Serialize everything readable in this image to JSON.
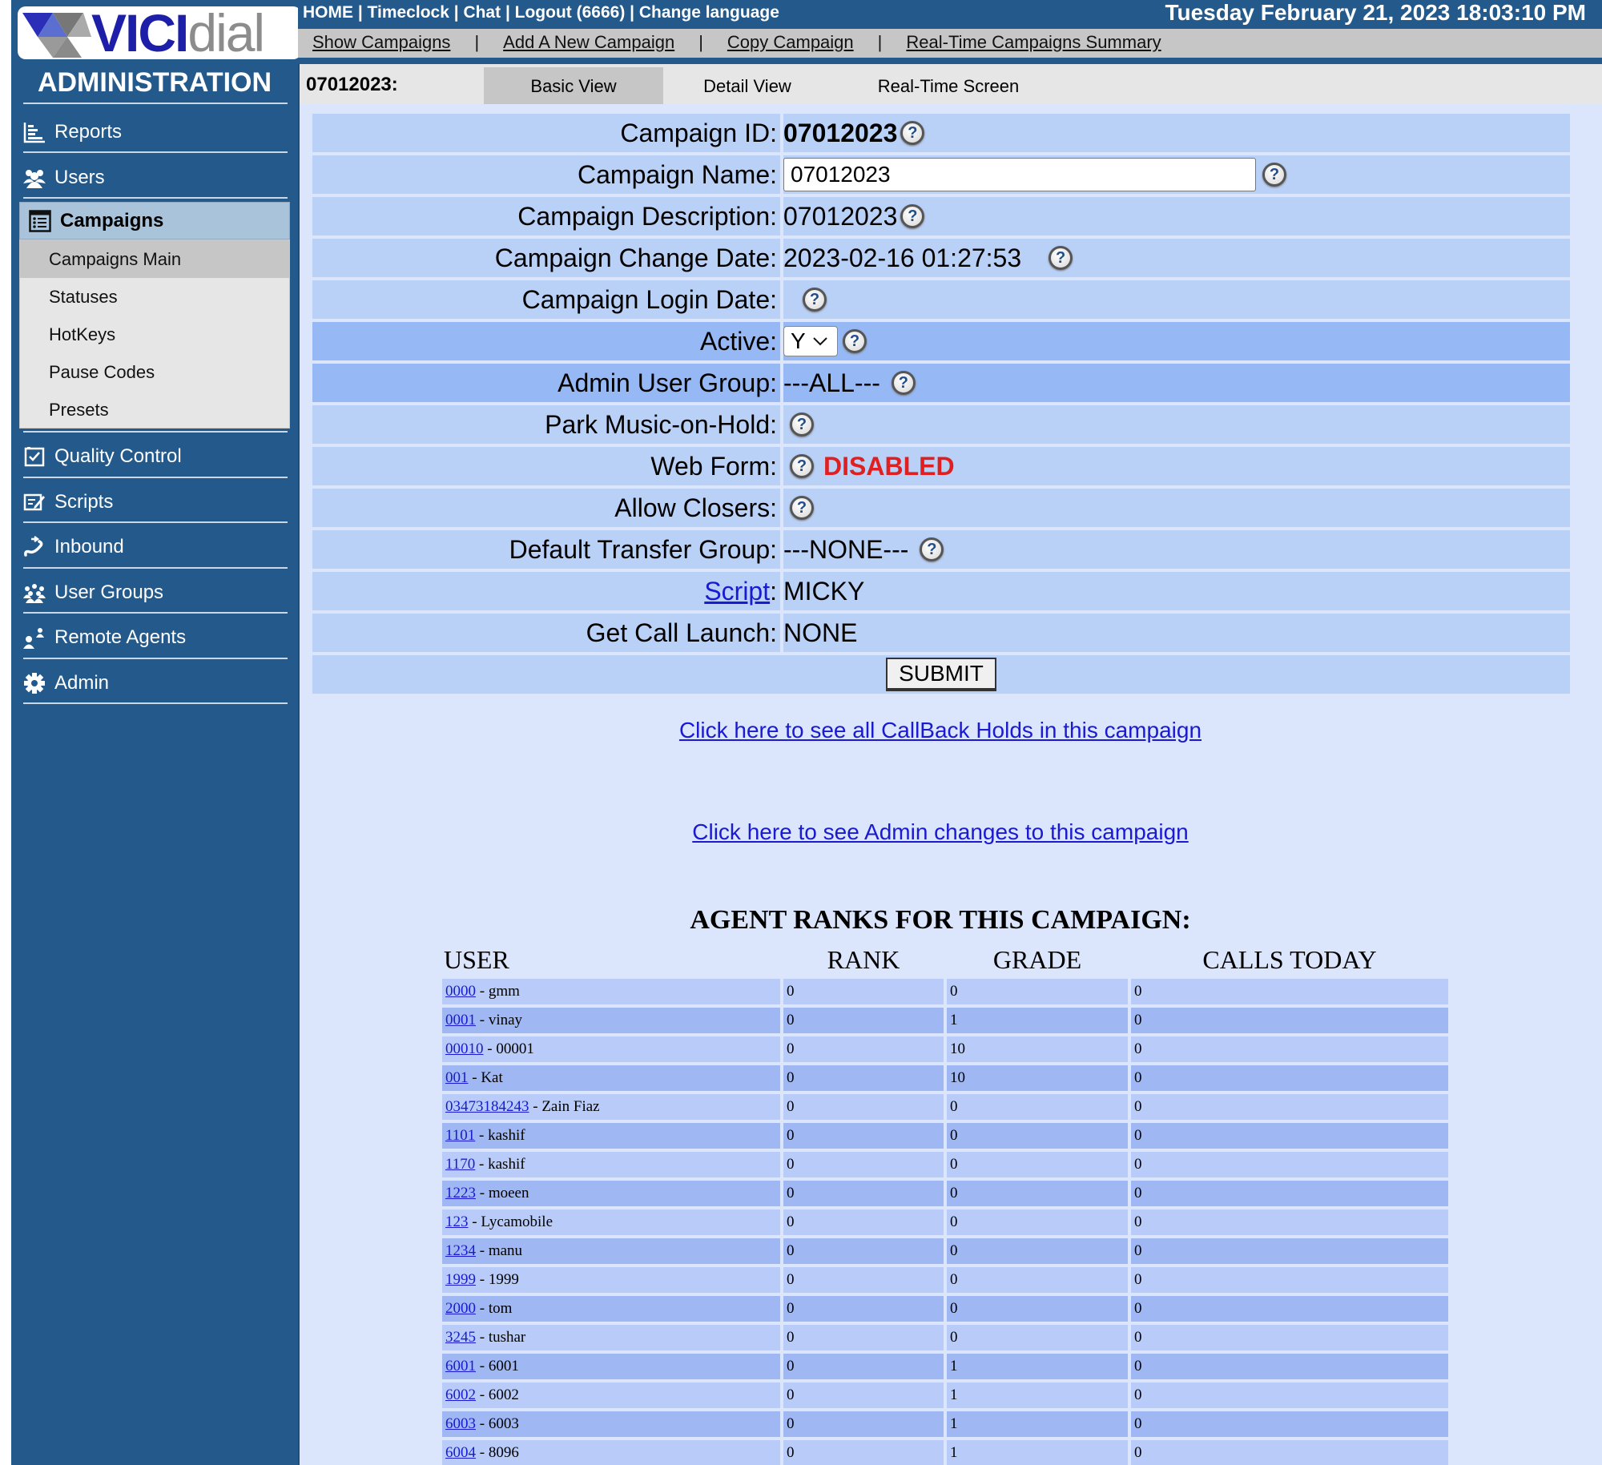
{
  "logo": {
    "text_vici": "VICI",
    "text_dial": "dial"
  },
  "sidebar": {
    "title": "ADMINISTRATION",
    "items": [
      {
        "label": "Reports",
        "icon": "bar-chart-icon"
      },
      {
        "label": "Users",
        "icon": "users-icon"
      },
      {
        "label": "Campaigns",
        "icon": "list-icon",
        "active": true
      },
      {
        "label": "Quality Control",
        "icon": "checkbox-icon"
      },
      {
        "label": "Scripts",
        "icon": "edit-icon"
      },
      {
        "label": "Inbound",
        "icon": "phone-incoming-icon"
      },
      {
        "label": "User Groups",
        "icon": "user-groups-icon"
      },
      {
        "label": "Remote Agents",
        "icon": "remote-agents-icon"
      },
      {
        "label": "Admin",
        "icon": "gear-icon"
      }
    ],
    "submenu": [
      {
        "label": "Campaigns Main",
        "active": true
      },
      {
        "label": "Statuses"
      },
      {
        "label": "HotKeys"
      },
      {
        "label": "Pause Codes"
      },
      {
        "label": "Presets"
      }
    ]
  },
  "topbar": {
    "links": [
      "HOME",
      "Timeclock",
      "Chat",
      "Logout (6666)",
      "Change language"
    ],
    "separator": " | ",
    "datetime": "Tuesday February 21, 2023 18:03:10 PM"
  },
  "submenubar": {
    "links": [
      "Show Campaigns",
      "Add A New Campaign",
      "Copy Campaign",
      "Real-Time Campaigns Summary"
    ],
    "separator": "|"
  },
  "tabs": {
    "campaign_label": "07012023:",
    "items": [
      {
        "label": "Basic View",
        "active": true
      },
      {
        "label": "Detail View"
      },
      {
        "label": "Real-Time Screen"
      }
    ]
  },
  "form": {
    "campaign_id": {
      "label": "Campaign ID:",
      "value": "07012023"
    },
    "campaign_name": {
      "label": "Campaign Name:",
      "value": "07012023"
    },
    "campaign_description": {
      "label": "Campaign Description:",
      "value": "07012023"
    },
    "campaign_change_date": {
      "label": "Campaign Change Date:",
      "value": "2023-02-16 01:27:53"
    },
    "campaign_login_date": {
      "label": "Campaign Login Date:",
      "value": ""
    },
    "active": {
      "label": "Active:",
      "value": "Y"
    },
    "admin_user_group": {
      "label": "Admin User Group:",
      "value": "---ALL---"
    },
    "park_moh": {
      "label": "Park Music-on-Hold:",
      "value": ""
    },
    "web_form": {
      "label": "Web Form:",
      "value": "DISABLED"
    },
    "allow_closers": {
      "label": "Allow Closers:",
      "value": ""
    },
    "default_transfer_group": {
      "label": "Default Transfer Group:",
      "value": "---NONE---"
    },
    "script": {
      "label_link": "Script",
      "label_suffix": ":",
      "value": "MICKY"
    },
    "get_call_launch": {
      "label": "Get Call Launch:",
      "value": "NONE"
    },
    "submit_label": "SUBMIT",
    "help_glyph": "?"
  },
  "links": {
    "callback_holds": "Click here to see all CallBack Holds in this campaign",
    "admin_changes": "Click here to see Admin changes to this campaign"
  },
  "agent_ranks": {
    "title": "AGENT RANKS FOR THIS CAMPAIGN:",
    "headers": [
      "USER",
      "RANK",
      "GRADE",
      "CALLS TODAY"
    ],
    "rows": [
      {
        "user_id": "0000",
        "name": " - gmm",
        "rank": "0",
        "grade": "0",
        "calls": "0"
      },
      {
        "user_id": "0001",
        "name": " - vinay",
        "rank": "0",
        "grade": "1",
        "calls": "0"
      },
      {
        "user_id": "00010",
        "name": " - 00001",
        "rank": "0",
        "grade": "10",
        "calls": "0"
      },
      {
        "user_id": "001",
        "name": " - Kat",
        "rank": "0",
        "grade": "10",
        "calls": "0"
      },
      {
        "user_id": "03473184243",
        "name": " - Zain Fiaz",
        "rank": "0",
        "grade": "0",
        "calls": "0"
      },
      {
        "user_id": "1101",
        "name": " - kashif",
        "rank": "0",
        "grade": "0",
        "calls": "0"
      },
      {
        "user_id": "1170",
        "name": " - kashif",
        "rank": "0",
        "grade": "0",
        "calls": "0"
      },
      {
        "user_id": "1223",
        "name": " - moeen",
        "rank": "0",
        "grade": "0",
        "calls": "0"
      },
      {
        "user_id": "123",
        "name": " - Lycamobile",
        "rank": "0",
        "grade": "0",
        "calls": "0"
      },
      {
        "user_id": "1234",
        "name": " - manu",
        "rank": "0",
        "grade": "0",
        "calls": "0"
      },
      {
        "user_id": "1999",
        "name": " - 1999",
        "rank": "0",
        "grade": "0",
        "calls": "0"
      },
      {
        "user_id": "2000",
        "name": " - tom",
        "rank": "0",
        "grade": "0",
        "calls": "0"
      },
      {
        "user_id": "3245",
        "name": " - tushar",
        "rank": "0",
        "grade": "0",
        "calls": "0"
      },
      {
        "user_id": "6001",
        "name": " - 6001",
        "rank": "0",
        "grade": "1",
        "calls": "0"
      },
      {
        "user_id": "6002",
        "name": " - 6002",
        "rank": "0",
        "grade": "1",
        "calls": "0"
      },
      {
        "user_id": "6003",
        "name": " - 6003",
        "rank": "0",
        "grade": "1",
        "calls": "0"
      },
      {
        "user_id": "6004",
        "name": " - 8096",
        "rank": "0",
        "grade": "1",
        "calls": "0"
      }
    ]
  },
  "colors": {
    "sidebar_bg": "#23598b",
    "main_bg": "#dbe5fb",
    "row_light": "#b9d0f7",
    "row_dark": "#96b8f5",
    "disabled_red": "#e02020",
    "link_blue": "#1a1ad0"
  }
}
